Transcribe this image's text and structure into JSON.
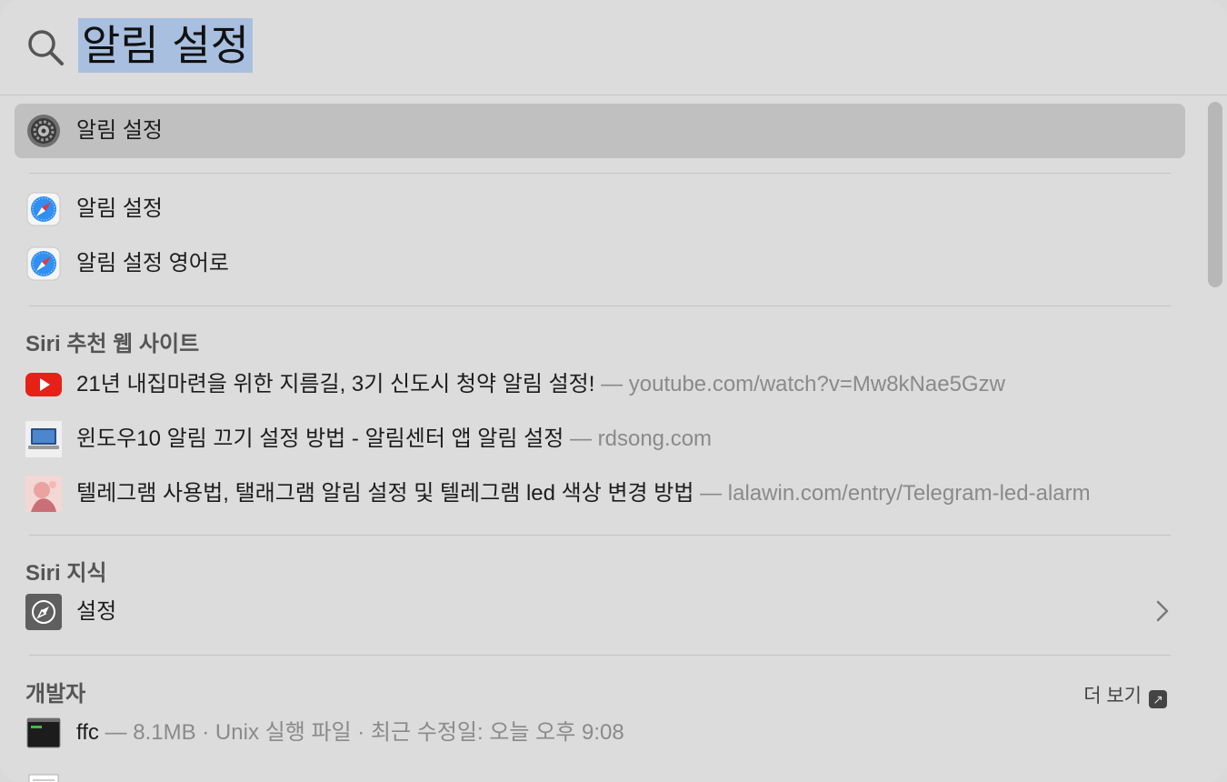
{
  "search": {
    "query": "알림 설정"
  },
  "top_hit": {
    "label": "알림 설정",
    "icon": "system-settings-gear-icon"
  },
  "safari_suggestions": [
    {
      "label": "알림 설정",
      "icon": "safari-compass-icon"
    },
    {
      "label": "알림 설정 영어로",
      "icon": "safari-compass-icon"
    }
  ],
  "siri_websites": {
    "title": "Siri 추천 웹 사이트",
    "items": [
      {
        "title": "21년 내집마련을 위한 지름길, 3기 신도시 청약 알림 설정!",
        "source": " — youtube.com/watch?v=Mw8kNae5Gzw",
        "icon": "youtube-icon",
        "accent": "#e62117"
      },
      {
        "title": "윈도우10 알림 끄기 설정 방법 - 알림센터 앱 알림 설정",
        "source": " — rdsong.com",
        "icon": "laptop-thumbnail-icon"
      },
      {
        "title": "텔레그램 사용법, 탤래그램 알림 설정 및 텔레그램 led 색상 변경 방법",
        "source": " — lalawin.com/entry/Telegram-led-alarm",
        "icon": "illustration-thumbnail-icon"
      }
    ]
  },
  "siri_knowledge": {
    "title": "Siri 지식",
    "item": {
      "label": "설정",
      "icon": "compass-icon"
    }
  },
  "developer": {
    "title": "개발자",
    "more_label": "더 보기",
    "items": [
      {
        "name": "ffc",
        "meta": " — 8.1MB · Unix 실행 파일 · 최근 수정일: 오늘 오후 9:08",
        "icon": "terminal-exec-icon"
      }
    ]
  },
  "colors": {
    "selection": "#a8bfe0",
    "selected_row": "#c0c0c0",
    "background": "#dcdcdc"
  }
}
